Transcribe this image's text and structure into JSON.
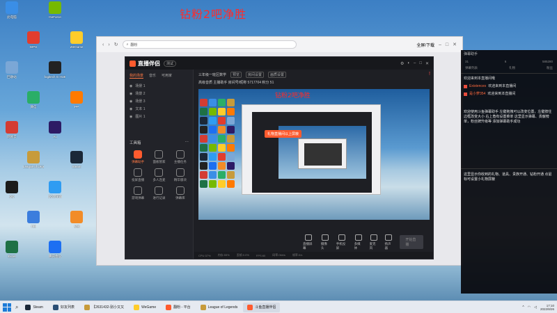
{
  "desktop": {
    "title": "钻粉2吧净胜",
    "icons": [
      {
        "label": "此电脑",
        "color": "#3a8ee6"
      },
      {
        "label": "回收站",
        "color": "#7ba7d6"
      },
      {
        "label": "网易云",
        "color": "#d43c33"
      },
      {
        "label": "QQ",
        "color": "#1b1b1b"
      },
      {
        "label": "Excel",
        "color": "#1e7145"
      },
      {
        "label": "WPS",
        "color": "#e13d2e"
      },
      {
        "label": "微信",
        "color": "#2aae67"
      },
      {
        "label": "League of Legends",
        "color": "#c79b3b"
      },
      {
        "label": "TIM",
        "color": "#3b7ddd"
      },
      {
        "label": "GeForce",
        "color": "#76b900"
      },
      {
        "label": "logitech G HUB",
        "color": "#222"
      },
      {
        "label": "Au",
        "color": "#2d1b65"
      },
      {
        "label": "QQ浏览器",
        "color": "#2f9cf2"
      },
      {
        "label": "腾讯会议",
        "color": "#1d6ff2"
      },
      {
        "label": "WeGame",
        "color": "#ffcc2a"
      },
      {
        "label": "PP",
        "color": "#ff7a00"
      },
      {
        "label": "Steam",
        "color": "#1b2838"
      },
      {
        "label": "火绒",
        "color": "#f28c28"
      }
    ]
  },
  "browser": {
    "address": "翻粉",
    "search_label": "全屏/下载"
  },
  "app": {
    "name": "直播伴侣",
    "version": "测试",
    "side_tabs": [
      "我的场景",
      "音乐",
      "可用家"
    ],
    "scenes": [
      "场景 1",
      "场景 2",
      "场景 3",
      "文本 1",
      "图片 1"
    ],
    "tools_title": "工具箱",
    "tools": [
      "弹幕助手",
      "面板管家",
      "主播任务",
      "投屏直播",
      "多人连麦",
      "精华版块",
      "游戏弹幕",
      "进行记录",
      "弹幕库"
    ],
    "info_title": "三年级一班区数学",
    "info_chips": [
      "预览",
      "房间设置",
      "画质设置"
    ],
    "info_row2": "高级音质   主播助手   房间号/昵称   5717704   积分 51",
    "preview_title": "钻粉2吧净胜",
    "banner": "礼物直播间以上屏蔽",
    "bottom_tools": [
      "直播屏幕",
      "摄像头",
      "手机投屏",
      "多媒体",
      "麦克风",
      "扬声器"
    ],
    "start_button": "开始直播",
    "status": [
      "CPU:37%",
      "内存:55%",
      "丢帧:0.0%",
      "FPS:60",
      "码率:0kb/s",
      "帧率:0/s"
    ],
    "warn_icon": "!"
  },
  "chat": {
    "head": "弹幕助手",
    "stats": [
      "31",
      "6",
      "585280"
    ],
    "tabs": [
      "弹幕列表",
      "礼物",
      "粉丝"
    ],
    "system": "欢迎来到本直播间哦",
    "messages": [
      {
        "name": "Existences",
        "text": "欢迎来到本直播间"
      },
      {
        "name": "是小萝354",
        "text": "欢迎来到本直播间"
      }
    ],
    "notice1": "欢迎使用斗鱼弹幕助手 左键拖拽可以改变位置，左键按住边框改变大小 右上角有设置菜单 这里显示弹幕、贡献榜单，粉丝牌升级等 添加弹幕助手成功",
    "notice2": "这里显示你收到的礼物、道具、贵族开通、钻粉开通 点鼠标可设置小礼物屏蔽"
  },
  "taskbar": {
    "apps": [
      {
        "label": "Steam",
        "color": "#1b2838"
      },
      {
        "label": "好友列表",
        "color": "#2a4e75"
      },
      {
        "label": "【2631432-别小又又",
        "color": "#c79b3b"
      },
      {
        "label": "WeGame",
        "color": "#ffcc2a"
      },
      {
        "label": "翻粉 - 平台",
        "color": "#ff5b2e"
      },
      {
        "label": "League of Legends",
        "color": "#c79b3b"
      },
      {
        "label": "斗鱼直播伴侣",
        "color": "#ff5b2e"
      }
    ],
    "time": "17:10",
    "date": "2022/8/26"
  }
}
